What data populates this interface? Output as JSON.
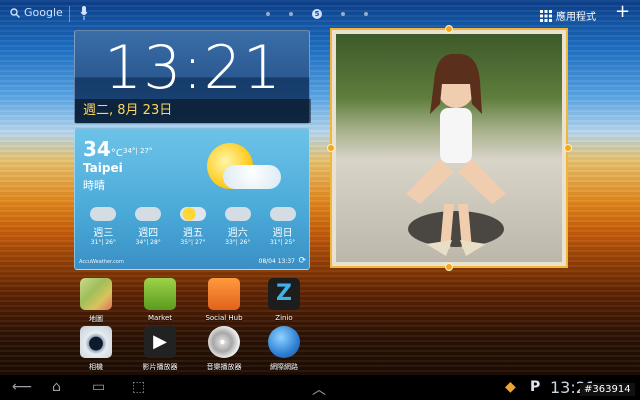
{
  "topbar": {
    "search_label": "Google",
    "apps_label": "應用程式",
    "pager_active": "5"
  },
  "clock": {
    "time": "13:21",
    "date": "週二, 8月 23日"
  },
  "weather": {
    "temp": "34",
    "unit": "°C",
    "range": "34°| 27°",
    "city": "Taipei",
    "condition": "時晴",
    "forecast": [
      {
        "day": "週三",
        "hl": "31°| 26°",
        "icon": "cloud-rain-icon"
      },
      {
        "day": "週四",
        "hl": "34°| 28°",
        "icon": "cloud-rain-icon"
      },
      {
        "day": "週五",
        "hl": "35°| 27°",
        "icon": "sun-cloud-icon"
      },
      {
        "day": "週六",
        "hl": "33°| 26°",
        "icon": "cloud-rain-icon"
      },
      {
        "day": "週日",
        "hl": "31°| 25°",
        "icon": "cloud-rain-icon"
      }
    ],
    "provider": "AccuWeather.com",
    "stamp": "08/04 13:37"
  },
  "apps": [
    {
      "label": "地圖"
    },
    {
      "label": "Market"
    },
    {
      "label": "Social Hub"
    },
    {
      "label": "Zinio"
    },
    {
      "label": "相機"
    },
    {
      "label": "影片播放器"
    },
    {
      "label": "音樂播放器"
    },
    {
      "label": "網際網路"
    }
  ],
  "navbar": {
    "clock": "13:21",
    "badge": "#363914"
  },
  "colors": {
    "accent": "#f0b63a",
    "date_text": "#ffd85a"
  }
}
